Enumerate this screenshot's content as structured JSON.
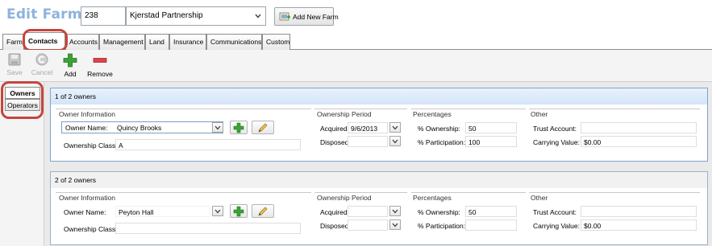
{
  "header": {
    "title": "Edit Farm",
    "farm_id": "238",
    "farm_name": "Kjerstad Partnership",
    "add_new_farm": "Add New Farm"
  },
  "tabs": [
    "Farm",
    "Contacts",
    "Accounts",
    "Management",
    "Land",
    "Insurance",
    "Communications",
    "Custom"
  ],
  "active_tab": "Contacts",
  "toolbar": {
    "save": "Save",
    "cancel": "Cancel",
    "add": "Add",
    "remove": "Remove"
  },
  "subtabs": [
    "Owners",
    "Operators"
  ],
  "active_subtab": "Owners",
  "labels": {
    "owner_information": "Owner Information",
    "owner_name": "Owner Name:",
    "ownership_class": "Ownership Class:",
    "ownership_period": "Ownership Period",
    "acquired": "Acquired:",
    "disposed": "Disposed:",
    "percentages": "Percentages",
    "pct_ownership": "% Ownership:",
    "pct_participation": "% Participation:",
    "other": "Other",
    "trust_account": "Trust Account:",
    "carrying_value": "Carrying Value:"
  },
  "owners": [
    {
      "header": "1 of 2 owners",
      "owner_name": "Quincy Brooks",
      "ownership_class": "A",
      "acquired": "9/6/2013",
      "disposed": "",
      "pct_ownership": "50",
      "pct_participation": "100",
      "trust_account": "",
      "carrying_value": "$0.00"
    },
    {
      "header": "2 of 2 owners",
      "owner_name": "Peyton Hall",
      "ownership_class": "",
      "acquired": "",
      "disposed": "",
      "pct_ownership": "50",
      "pct_participation": "",
      "trust_account": "",
      "carrying_value": "$0.00"
    }
  ],
  "colors": {
    "title": "#8db3dc",
    "highlight_ring": "#c4463d",
    "add_green": "#3aa335",
    "remove_red": "#d9434a",
    "selected_panel_header": "#d4e4f7"
  }
}
